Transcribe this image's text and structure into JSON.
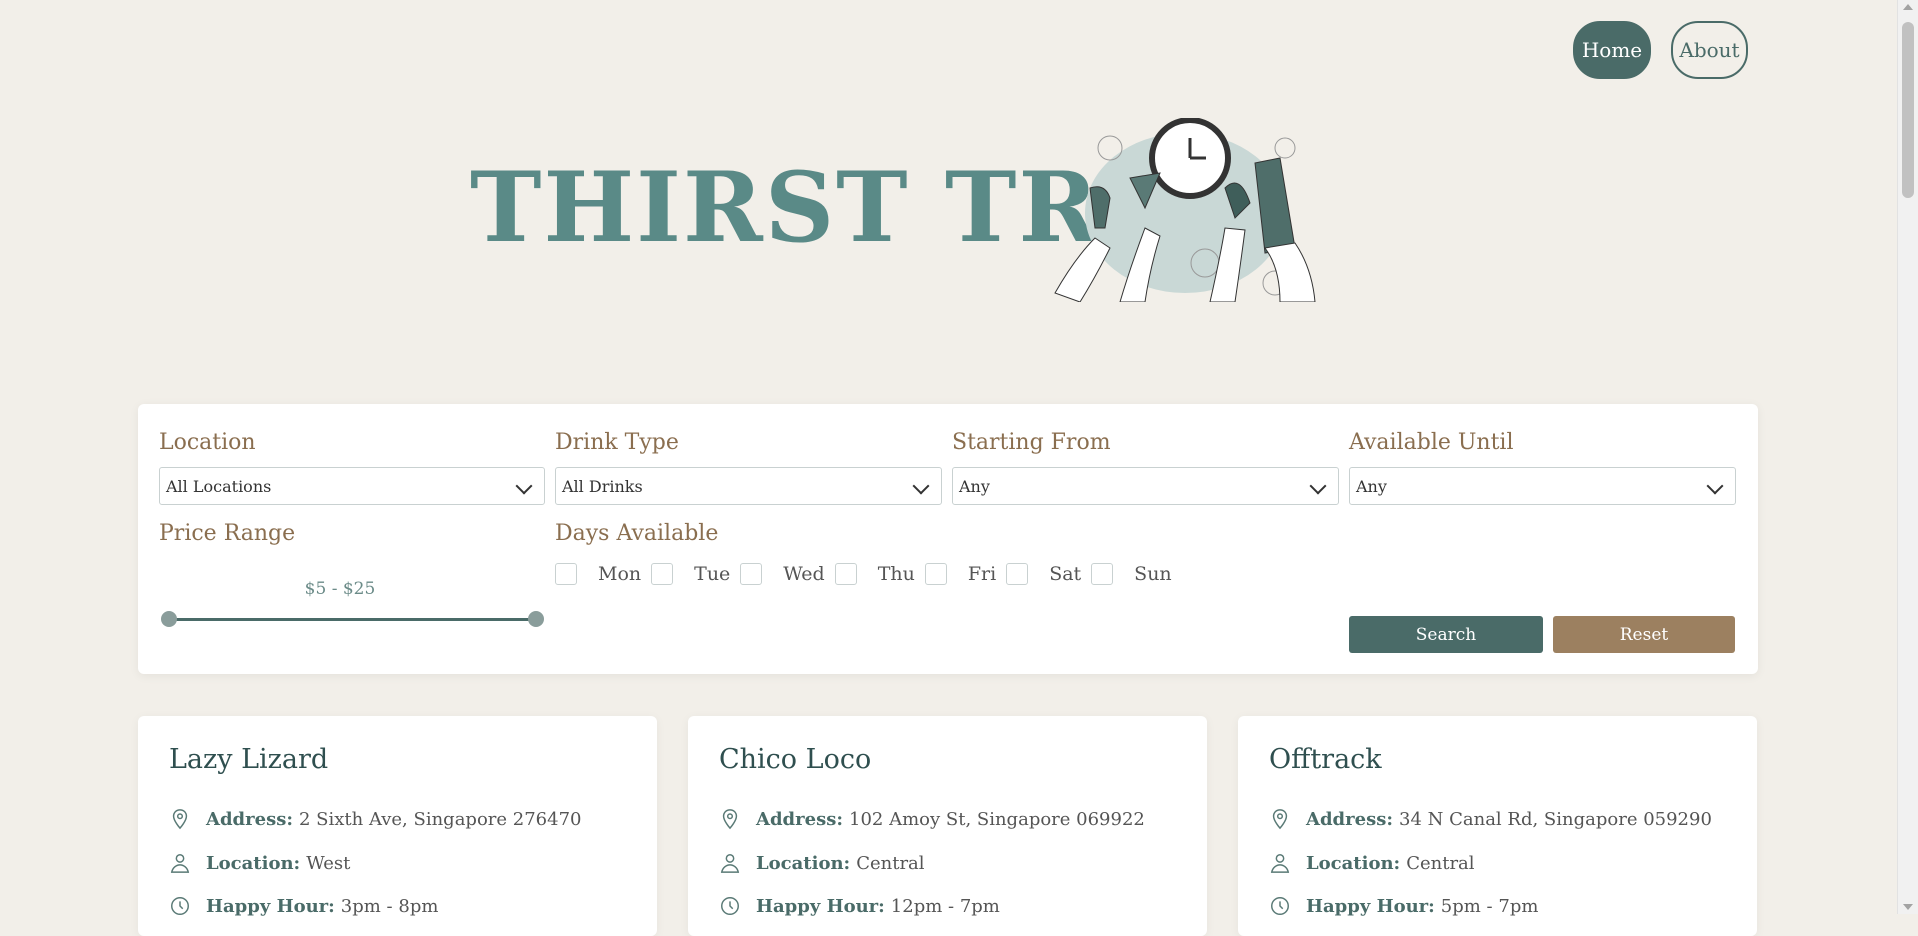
{
  "nav": {
    "home": "Home",
    "about": "About"
  },
  "hero": {
    "title": "THIRST TRAP"
  },
  "filters": {
    "location": {
      "label": "Location",
      "value": "All Locations"
    },
    "drink_type": {
      "label": "Drink Type",
      "value": "All Drinks"
    },
    "starting_from": {
      "label": "Starting From",
      "value": "Any"
    },
    "available_until": {
      "label": "Available Until",
      "value": "Any"
    },
    "price_range": {
      "label": "Price Range",
      "text": "$5 - $25",
      "min": 5,
      "max": 25
    },
    "days": {
      "label": "Days Available",
      "items": [
        "Mon",
        "Tue",
        "Wed",
        "Thu",
        "Fri",
        "Sat",
        "Sun"
      ]
    },
    "search_label": "Search",
    "reset_label": "Reset"
  },
  "bars": [
    {
      "name": "Lazy Lizard",
      "address_label": "Address:",
      "address": "2 Sixth Ave, Singapore 276470",
      "location_label": "Location:",
      "location": "West",
      "happy_label": "Happy Hour:",
      "happy_hour": "3pm - 8pm"
    },
    {
      "name": "Chico Loco",
      "address_label": "Address:",
      "address": "102 Amoy St, Singapore 069922",
      "location_label": "Location:",
      "location": "Central",
      "happy_label": "Happy Hour:",
      "happy_hour": "12pm - 7pm"
    },
    {
      "name": "Offtrack",
      "address_label": "Address:",
      "address": "34 N Canal Rd, Singapore 059290",
      "location_label": "Location:",
      "location": "Central",
      "happy_label": "Happy Hour:",
      "happy_hour": "5pm - 7pm"
    }
  ],
  "colors": {
    "primary": "#4a6b68",
    "accent": "#9c8060",
    "title": "#5a8a87",
    "background": "#f2efe9"
  }
}
